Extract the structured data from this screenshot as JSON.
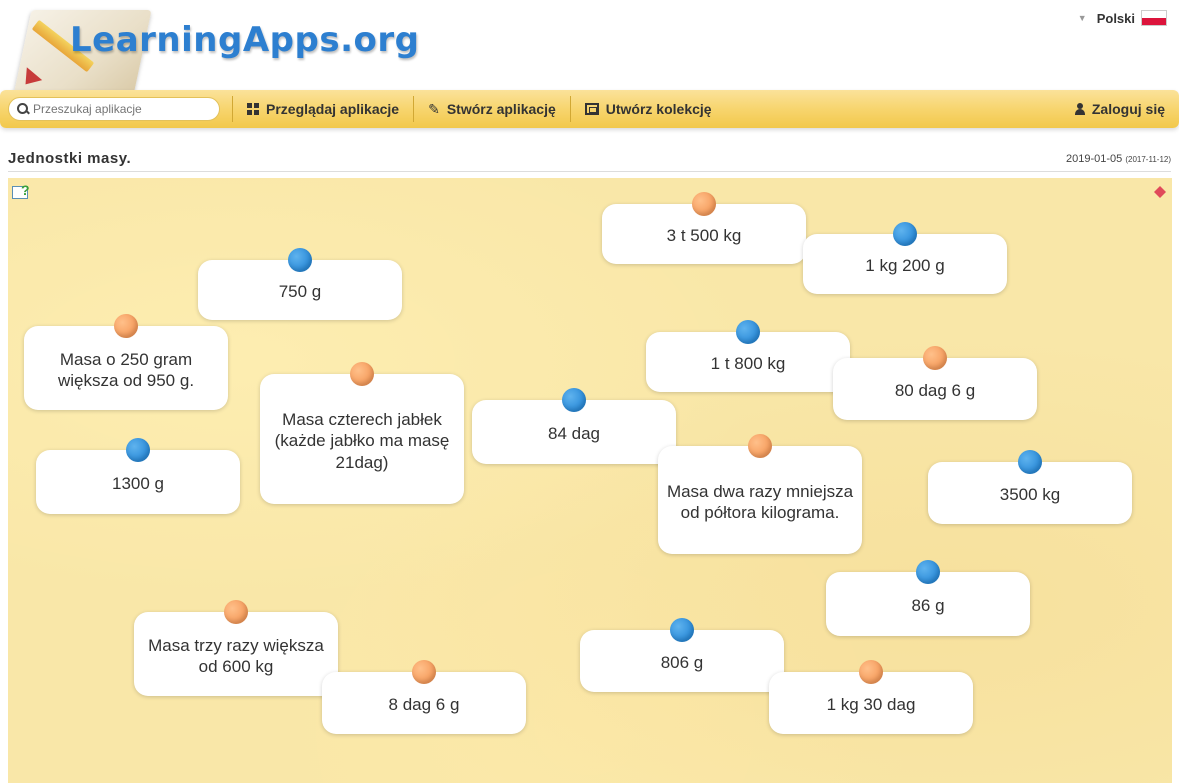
{
  "header": {
    "logo_text": "LearningApps.org",
    "language": "Polski"
  },
  "nav": {
    "search_placeholder": "Przeszukaj aplikacje",
    "browse": "Przeglądaj aplikacje",
    "create": "Stwórz aplikację",
    "collection": "Utwórz kolekcję",
    "login": "Zaloguj się"
  },
  "page": {
    "title": "Jednostki masy.",
    "date": "2019-01-05",
    "date_small": "(2017-11-12)"
  },
  "cards": [
    {
      "text": "3 t 500 kg",
      "pin": "orange"
    },
    {
      "text": "1 kg 200 g",
      "pin": "blue"
    },
    {
      "text": "750 g",
      "pin": "blue"
    },
    {
      "text": "Masa o 250 gram większa od 950 g.",
      "pin": "orange"
    },
    {
      "text": "1 t 800 kg",
      "pin": "blue"
    },
    {
      "text": "80 dag 6 g",
      "pin": "orange"
    },
    {
      "text": "Masa czterech jabłek (każde jabłko ma masę 21dag)",
      "pin": "orange"
    },
    {
      "text": "84 dag",
      "pin": "blue"
    },
    {
      "text": "1300 g",
      "pin": "blue"
    },
    {
      "text": "Masa dwa razy mniejsza od półtora kilograma.",
      "pin": "orange"
    },
    {
      "text": "3500 kg",
      "pin": "blue"
    },
    {
      "text": "86 g",
      "pin": "blue"
    },
    {
      "text": "Masa trzy razy większa od 600 kg",
      "pin": "orange"
    },
    {
      "text": "806 g",
      "pin": "blue"
    },
    {
      "text": "8 dag 6 g",
      "pin": "orange"
    },
    {
      "text": "1 kg 30 dag",
      "pin": "orange"
    }
  ]
}
